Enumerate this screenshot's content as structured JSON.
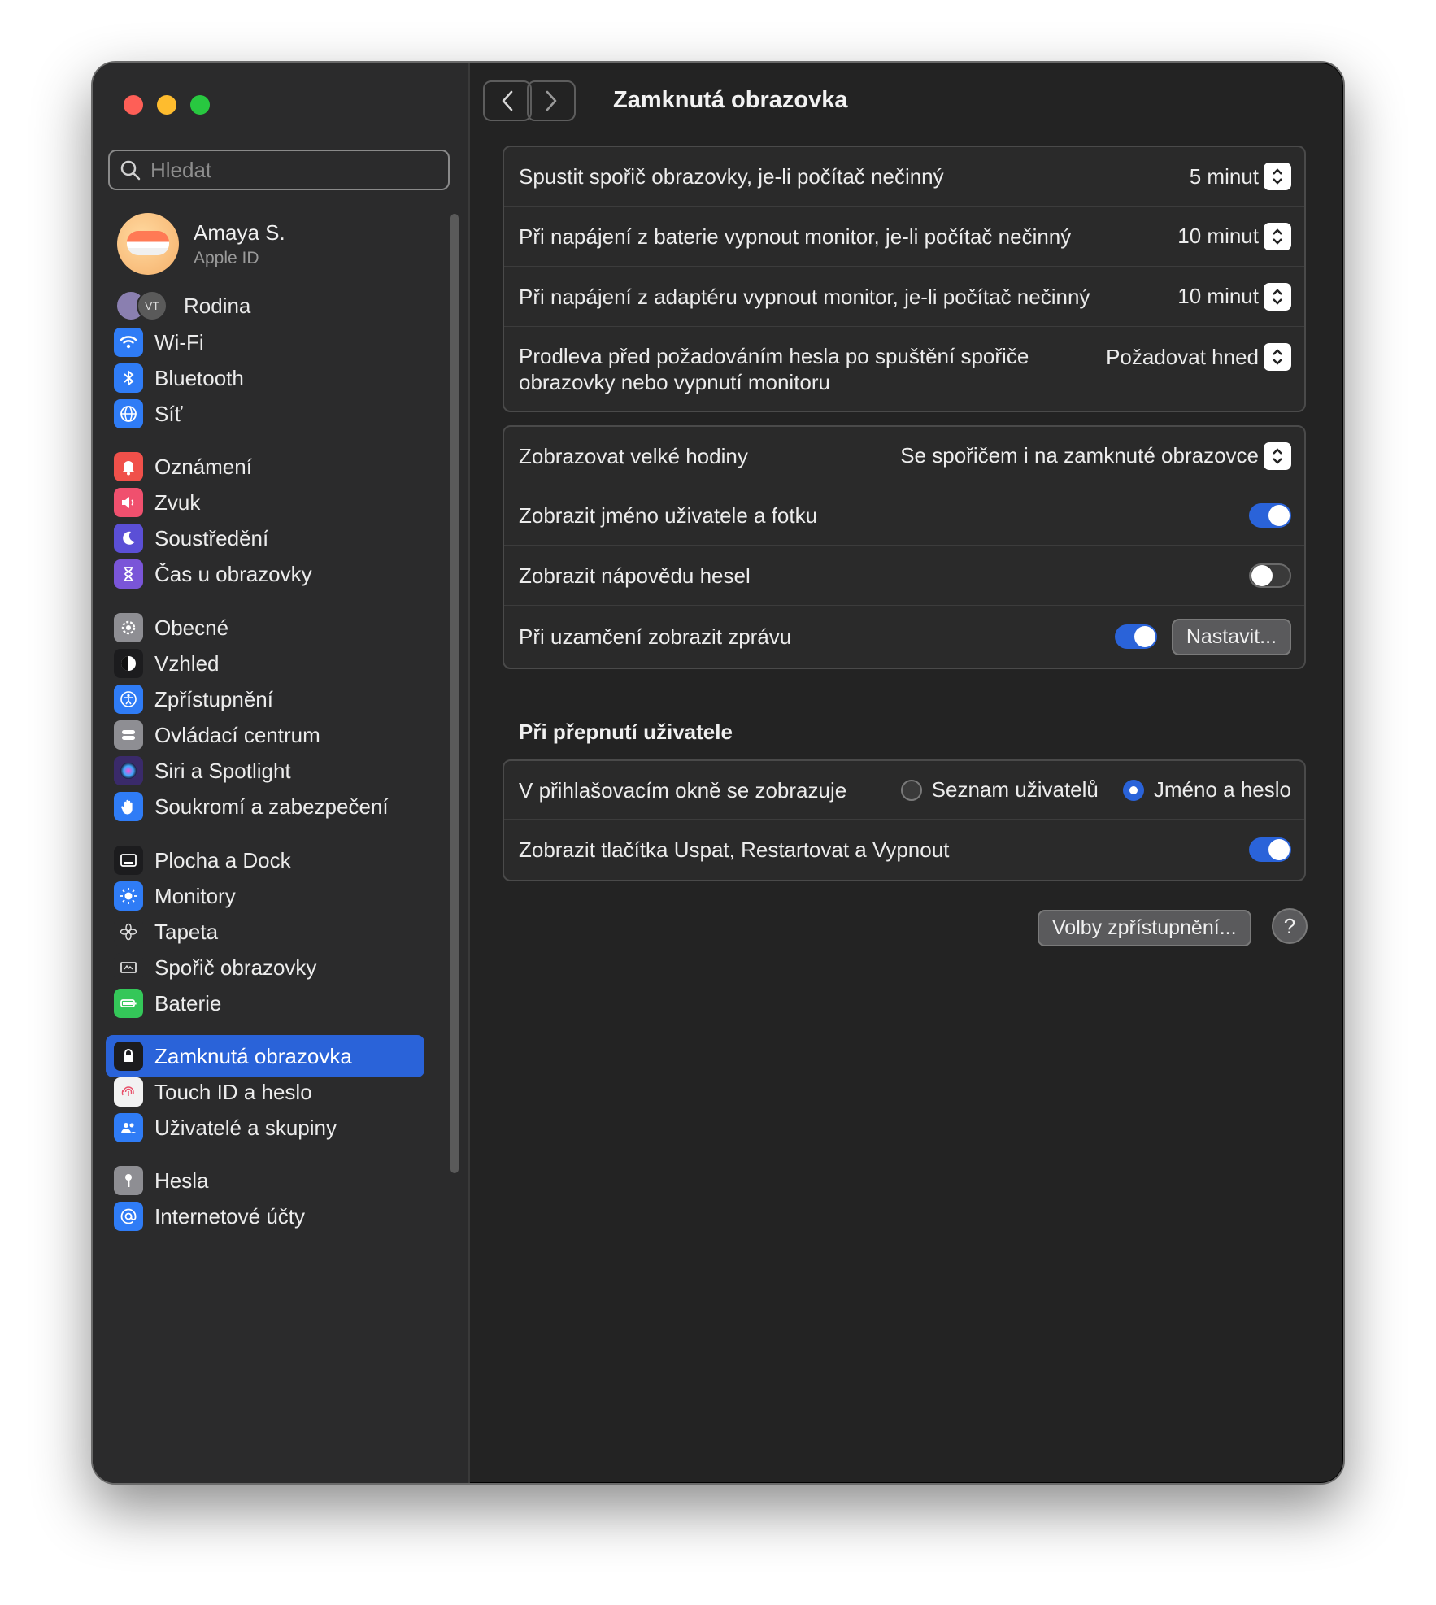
{
  "window": {
    "title": "Zamknutá obrazovka"
  },
  "search": {
    "placeholder": "Hledat"
  },
  "profile": {
    "name": "Amaya S.",
    "subtitle": "Apple ID"
  },
  "family": {
    "label": "Rodina",
    "initials": "VT"
  },
  "sidebar": {
    "items": [
      {
        "label": "Wi-Fi",
        "icon": "wifi-icon",
        "color": "#2f7cf6"
      },
      {
        "label": "Bluetooth",
        "icon": "bluetooth-icon",
        "color": "#2f7cf6"
      },
      {
        "label": "Síť",
        "icon": "globe-icon",
        "color": "#2f7cf6"
      },
      {
        "label": "Oznámení",
        "icon": "bell-icon",
        "color": "#f0504a"
      },
      {
        "label": "Zvuk",
        "icon": "speaker-icon",
        "color": "#f0506e"
      },
      {
        "label": "Soustředění",
        "icon": "moon-icon",
        "color": "#5b4fd6"
      },
      {
        "label": "Čas u obrazovky",
        "icon": "hourglass-icon",
        "color": "#7a55d8"
      },
      {
        "label": "Obecné",
        "icon": "gear-icon",
        "color": "#8e8e93"
      },
      {
        "label": "Vzhled",
        "icon": "appearance-icon",
        "color": "#1c1c1e"
      },
      {
        "label": "Zpřístupnění",
        "icon": "accessibility-icon",
        "color": "#2f7cf6"
      },
      {
        "label": "Ovládací centrum",
        "icon": "control-center-icon",
        "color": "#8e8e93"
      },
      {
        "label": "Siri a Spotlight",
        "icon": "siri-icon",
        "color": "#3a2a6a"
      },
      {
        "label": "Soukromí a zabezpečení",
        "icon": "hand-icon",
        "color": "#2f7cf6"
      },
      {
        "label": "Plocha a Dock",
        "icon": "dock-icon",
        "color": "#1c1c1e"
      },
      {
        "label": "Monitory",
        "icon": "sun-icon",
        "color": "#2f7cf6"
      },
      {
        "label": "Tapeta",
        "icon": "flower-icon",
        "color": "#2b2b2c"
      },
      {
        "label": "Spořič obrazovky",
        "icon": "screensaver-icon",
        "color": "#2b2b2c"
      },
      {
        "label": "Baterie",
        "icon": "battery-icon",
        "color": "#34c759"
      },
      {
        "label": "Zamknutá obrazovka",
        "icon": "lock-icon",
        "color": "#1c1c1e"
      },
      {
        "label": "Touch ID a heslo",
        "icon": "fingerprint-icon",
        "color": "#f2f2f2"
      },
      {
        "label": "Uživatelé a skupiny",
        "icon": "users-icon",
        "color": "#2f7cf6"
      },
      {
        "label": "Hesla",
        "icon": "key-icon",
        "color": "#8e8e93"
      },
      {
        "label": "Internetové účty",
        "icon": "at-icon",
        "color": "#2f7cf6"
      }
    ]
  },
  "group1": [
    {
      "label": "Spustit spořič obrazovky, je-li počítač nečinný",
      "value": "5 minut"
    },
    {
      "label": "Při napájení z baterie vypnout monitor, je-li počítač nečinný",
      "value": "10 minut"
    },
    {
      "label": "Při napájení z adaptéru vypnout monitor, je-li počítač nečinný",
      "value": "10 minut"
    },
    {
      "label": "Prodleva před požadováním hesla po spuštění spořiče obrazovky nebo vypnutí monitoru",
      "value": "Požadovat hned"
    }
  ],
  "group2": {
    "clock": {
      "label": "Zobrazovat velké hodiny",
      "value": "Se spořičem i na zamknuté obrazovce"
    },
    "show_name": {
      "label": "Zobrazit jméno uživatele a fotku",
      "on": true
    },
    "show_hint": {
      "label": "Zobrazit nápovědu hesel",
      "on": false
    },
    "show_message": {
      "label": "Při uzamčení zobrazit zprávu",
      "on": true,
      "button": "Nastavit..."
    }
  },
  "switch_user": {
    "title": "Při přepnutí uživatele",
    "login_window": {
      "label": "V přihlašovacím okně se zobrazuje",
      "option1": "Seznam uživatelů",
      "option2": "Jméno a heslo",
      "selected": "Jméno a heslo"
    },
    "buttons": {
      "label": "Zobrazit tlačítka Uspat, Restartovat a Vypnout",
      "on": true
    }
  },
  "footer": {
    "accessibility_button": "Volby zpřístupnění...",
    "help": "?"
  },
  "colors": {
    "accent": "#2a63d9",
    "window_bg": "#232323",
    "sidebar_bg": "#2b2b2c"
  }
}
